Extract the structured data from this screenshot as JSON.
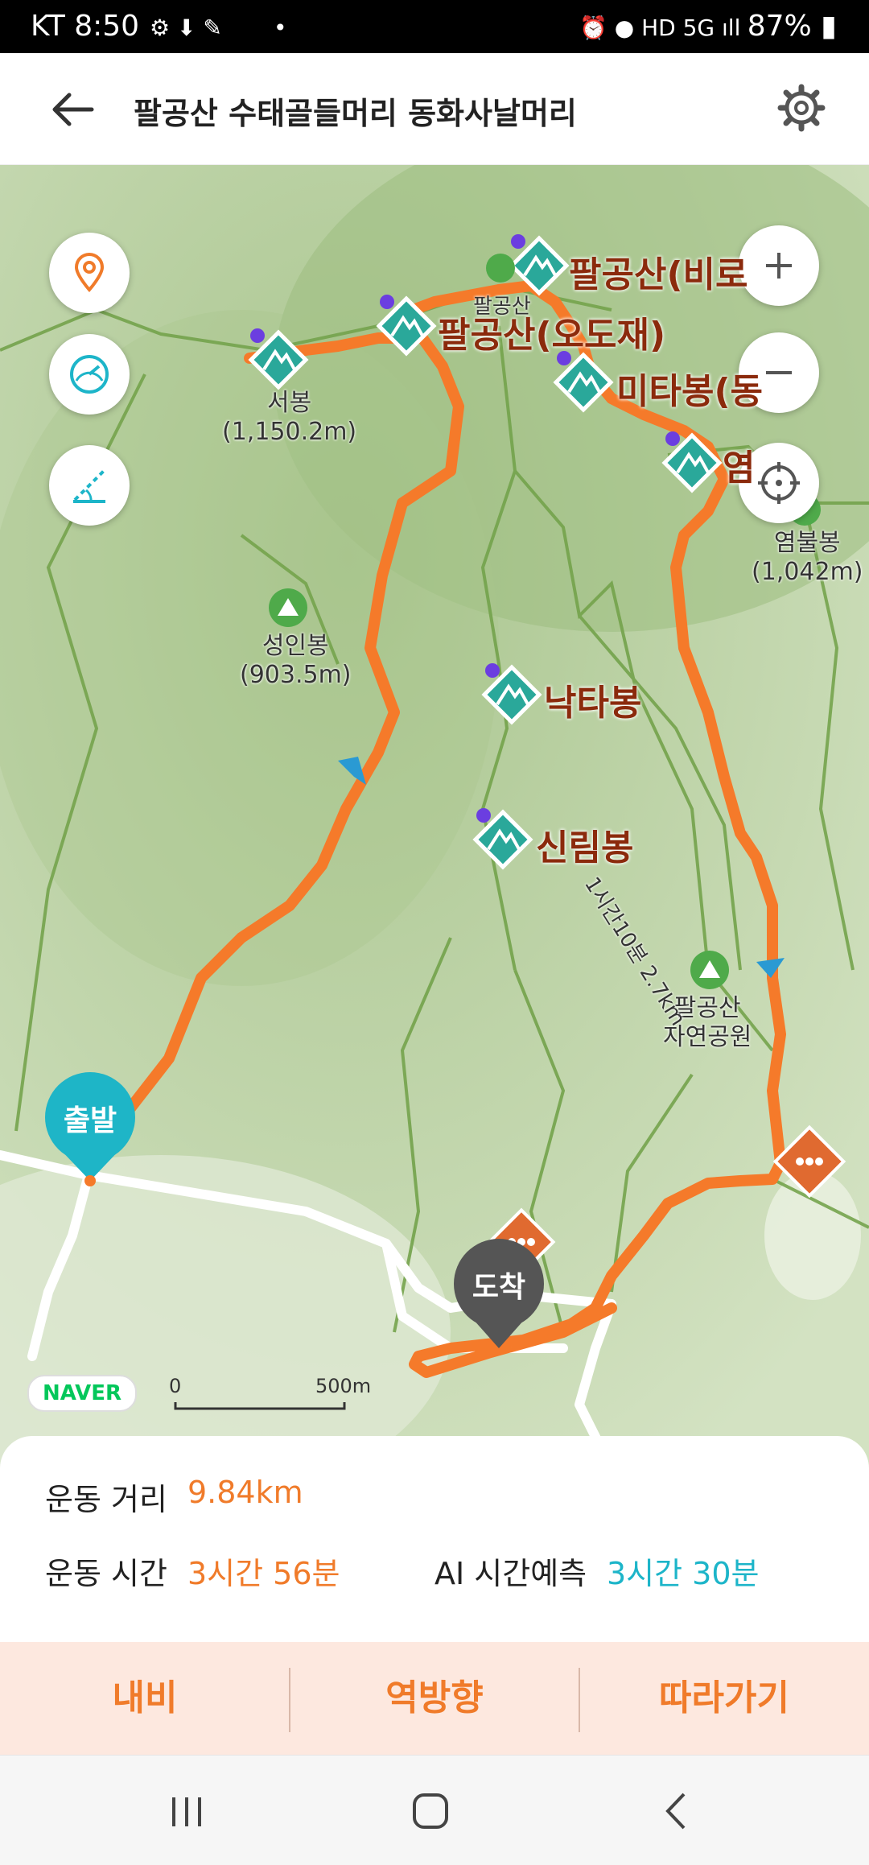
{
  "status_bar": {
    "carrier_time": "KT 8:50",
    "battery": "87%",
    "dot": "•"
  },
  "header": {
    "title": "팔공산 수태골들머리 동화사날머리"
  },
  "map": {
    "peaks": [
      {
        "name": "팔공산(비로",
        "key": "biro"
      },
      {
        "name": "팔공산(오도재)",
        "key": "odojae"
      },
      {
        "name": "미타봉(동",
        "key": "mita"
      },
      {
        "name": "염",
        "key": "yeom"
      },
      {
        "name": "낙타봉",
        "key": "nakta"
      },
      {
        "name": "신림봉",
        "key": "sinrim"
      }
    ],
    "labels": {
      "seobong": [
        "서봉",
        "(1,150.2m)"
      ],
      "seongin": [
        "성인봉",
        "(903.5m)"
      ],
      "yeombul": [
        "염불봉",
        "(1,042m)"
      ],
      "park": [
        "팔공산",
        "자연공원"
      ],
      "palgong_small": "팔공산",
      "trail_time": "1시간10분 2.7km"
    },
    "start_label": "출발",
    "end_label": "도착",
    "naver": "NAVER",
    "scale_zero": "0",
    "scale_max": "500m"
  },
  "stats": {
    "distance_label": "운동 거리",
    "distance_value": "9.84km",
    "time_label": "운동 시간",
    "time_value": "3시간 56분",
    "ai_label": "AI 시간예측",
    "ai_value": "3시간 30분"
  },
  "actions": {
    "navi": "내비",
    "reverse": "역방향",
    "follow": "따라가기"
  },
  "colors": {
    "route": "#f57a2a",
    "accent": "#f07b2a",
    "ai": "#1db5c9",
    "peak": "#2aa89a"
  }
}
